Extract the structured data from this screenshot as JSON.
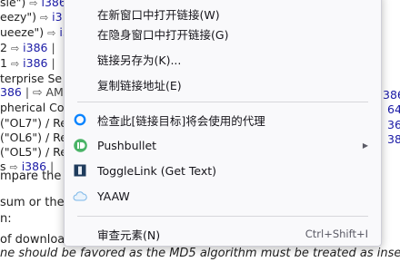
{
  "background": {
    "lines": [
      {
        "pre": "sle\")",
        "arrow": "⇨",
        "link": "i386"
      },
      {
        "pre": "eezy\")",
        "arrow": "⇨",
        "link": "i3"
      },
      {
        "pre": "ueeze\")",
        "arrow": "⇨",
        "link": "i3"
      },
      {
        "pre": "2",
        "arrow": "⇨",
        "link": "i386",
        "post": "|"
      },
      {
        "pre": "1",
        "arrow": "⇨",
        "link": "i386",
        "post": "|"
      },
      {
        "pre": "terprise Se"
      },
      {
        "link": "386",
        "post": "| ⇨ AM"
      },
      {
        "pre": "pherical Cov"
      },
      {
        "pre": "(\"OL7\") / Re"
      },
      {
        "pre": "(\"OL6\") / Re"
      },
      {
        "pre": "(\"OL5\") / Re"
      },
      {
        "pre": "s",
        "arrow": "⇨",
        "link": "i386",
        "post": "|"
      }
    ],
    "prose": [
      "mpare the",
      "sum or the",
      "n:",
      "of downloa"
    ],
    "bottom_italic": "ne should be favored as the MD5 algorithm must be treated as insec",
    "right_fragments": [
      "386",
      "64",
      "36",
      "38"
    ]
  },
  "menu": {
    "items": [
      {
        "label": "在新窗口中打开链接(W)"
      },
      {
        "label": "在隐身窗口中打开链接(G)"
      },
      {
        "label": "链接另存为(K)..."
      },
      {
        "label": "复制链接地址(E)"
      },
      {
        "label": "检查此[链接目标]将会使用的代理",
        "icon": "proxy-check-icon"
      },
      {
        "label": "Pushbullet",
        "icon": "pushbullet-icon",
        "submenu_arrow": "▶"
      },
      {
        "label": "ToggleLink (Get Text)",
        "icon": "togglelink-icon"
      },
      {
        "label": "YAAW",
        "icon": "yaaw-cloud-icon"
      },
      {
        "label": "审查元素(N)",
        "shortcut": "Ctrl+Shift+I"
      }
    ]
  },
  "colors": {
    "menu_bg": "#f9f9fb",
    "link": "#1a1aa6",
    "proxy_icon": "#0a84ff",
    "pushbullet_icon": "#4ab367",
    "togglelink_icon": "#1f3b5c",
    "yaaw_icon": "#7ab6e8"
  }
}
